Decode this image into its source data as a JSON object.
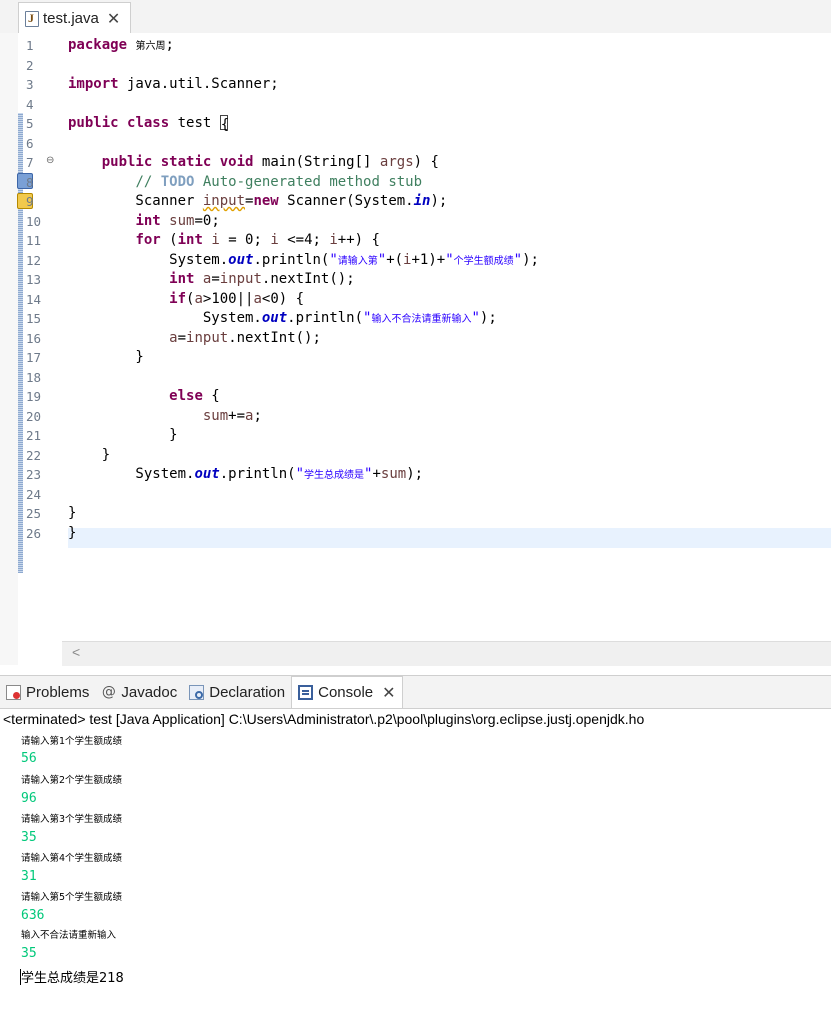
{
  "editor": {
    "tab_title": "test.java",
    "tab_close": "✕",
    "code_lines": [
      "package 第六周;",
      "",
      "import java.util.Scanner;",
      "",
      "public class test {",
      "",
      "    public static void main(String[] args) {",
      "        // TODO Auto-generated method stub",
      "        Scanner input=new Scanner(System.in);",
      "        int sum=0;",
      "        for (int i = 0; i <=4; i++) {",
      "            System.out.println(\"请输入第\"+(i+1)+\"个学生额成绩\");",
      "            int a=input.nextInt();",
      "            if(a>100||a<0) {",
      "                System.out.println(\"输入不合法请重新输入\");",
      "            a=input.nextInt();",
      "        }",
      "",
      "            else {",
      "                sum+=a;",
      "            }",
      "    }",
      "        System.out.println(\"学生总成绩是\"+sum);",
      "",
      "}",
      "}"
    ],
    "line_numbers": [
      "1",
      "2",
      "3",
      "4",
      "5",
      "6",
      "7",
      "8",
      "9",
      "10",
      "11",
      "12",
      "13",
      "14",
      "15",
      "16",
      "17",
      "18",
      "19",
      "20",
      "21",
      "22",
      "23",
      "24",
      "25",
      "26"
    ],
    "fold_marker": "⊖",
    "scroll_left": "<"
  },
  "panel": {
    "tabs": [
      {
        "label": "Problems",
        "icon": "problems-icon"
      },
      {
        "label": "Javadoc",
        "icon": "at-icon"
      },
      {
        "label": "Declaration",
        "icon": "declaration-icon"
      },
      {
        "label": "Console",
        "icon": "console-icon",
        "active": true
      }
    ],
    "close": "✕",
    "at_symbol": "@",
    "status": "<terminated> test [Java Application] C:\\Users\\Administrator\\.p2\\pool\\plugins\\org.eclipse.justj.openjdk.ho",
    "output": [
      {
        "text": "请输入第1个学生额成绩",
        "kind": "out"
      },
      {
        "text": "56",
        "kind": "in"
      },
      {
        "text": "请输入第2个学生额成绩",
        "kind": "out"
      },
      {
        "text": "96",
        "kind": "in"
      },
      {
        "text": "请输入第3个学生额成绩",
        "kind": "out"
      },
      {
        "text": "35",
        "kind": "in"
      },
      {
        "text": "请输入第4个学生额成绩",
        "kind": "out"
      },
      {
        "text": "31",
        "kind": "in"
      },
      {
        "text": "请输入第5个学生额成绩",
        "kind": "out"
      },
      {
        "text": "636",
        "kind": "in"
      },
      {
        "text": "输入不合法请重新输入",
        "kind": "out"
      },
      {
        "text": "35",
        "kind": "in"
      },
      {
        "text": "学生总成绩是218",
        "kind": "final"
      }
    ]
  },
  "colors": {
    "keyword": "#7f0055",
    "comment": "#3f7f5f",
    "string": "#2a00ff",
    "field": "#0000c0",
    "console_input": "#00c87a",
    "current_line": "#e8f2fe"
  }
}
